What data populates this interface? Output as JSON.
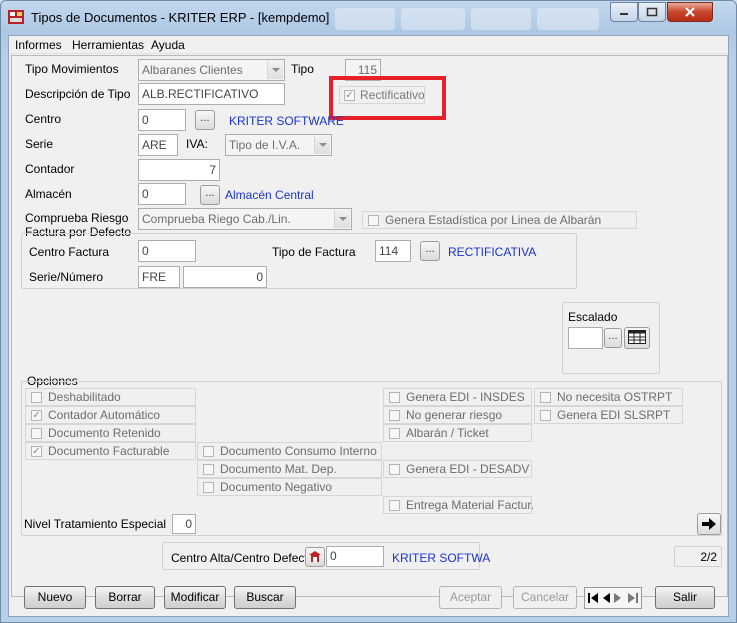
{
  "window": {
    "title": "Tipos de Documentos - KRITER ERP - [kempdemo]"
  },
  "menu": [
    "Informes",
    "Herramientas",
    "Ayuda"
  ],
  "form": {
    "tipo_movimientos_label": "Tipo Movimientos",
    "tipo_movimientos_value": "Albaranes Clientes",
    "tipo_label": "Tipo",
    "tipo_value": "115",
    "descripcion_label": "Descripción de Tipo",
    "descripcion_value": "ALB.RECTIFICATIVO",
    "rectificativo_label": "Rectificativo",
    "centro_label": "Centro",
    "centro_value": "0",
    "centro_name": "KRITER SOFTWARE",
    "serie_label": "Serie",
    "serie_value": "ARE",
    "iva_label": "IVA:",
    "iva_value": "Tipo de I.V.A.",
    "contador_label": "Contador",
    "contador_value": "7",
    "almacen_label": "Almacén",
    "almacen_value": "0",
    "almacen_name": "Almacén Central",
    "comprueba_label": "Comprueba Riesgo",
    "comprueba_value": "Comprueba Riego Cab./Lin.",
    "genera_estadistica_label": "Genera Estadística por Linea de Albarán",
    "factura_defecto_label": "Factura por Defecto",
    "centro_factura_label": "Centro Factura",
    "centro_factura_value": "0",
    "tipo_factura_label": "Tipo de Factura",
    "tipo_factura_value": "114",
    "tipo_factura_name": "RECTIFICATIVA",
    "serie_numero_label": "Serie/Número",
    "serie_numero_serie": "FRE",
    "serie_numero_numero": "0",
    "escalado_label": "Escalado"
  },
  "opciones": {
    "title": "Opciones",
    "col1": [
      {
        "label": "Deshabilitado",
        "checked": false
      },
      {
        "label": "Contador Automático",
        "checked": true
      },
      {
        "label": "Documento Retenido",
        "checked": false
      },
      {
        "label": "Documento Facturable",
        "checked": true
      }
    ],
    "col2": [
      {
        "label": "Documento Consumo Interno",
        "checked": false
      },
      {
        "label": "Documento Mat. Dep.",
        "checked": false
      },
      {
        "label": "Documento Negativo",
        "checked": false
      }
    ],
    "col3": [
      {
        "label": "Genera EDI - INSDES",
        "checked": false
      },
      {
        "label": "No generar riesgo",
        "checked": false
      },
      {
        "label": "Albarán / Ticket",
        "checked": false
      },
      {
        "label": "Genera EDI - DESADV",
        "checked": false
      },
      {
        "label": "Entrega Material Factur.",
        "checked": false
      }
    ],
    "col4": [
      {
        "label": "No necesita OSTRPT",
        "checked": false
      },
      {
        "label": "Genera EDI SLSRPT",
        "checked": false
      }
    ],
    "nivel_label": "Nivel Tratamiento Especial",
    "nivel_value": "0"
  },
  "footer_panel": {
    "centro_alta_label": "Centro Alta/Centro Defecto",
    "centro_alta_value": "0",
    "centro_alta_name": "KRITER SOFTWA",
    "page_indicator": "2/2"
  },
  "buttons": {
    "nuevo": "Nuevo",
    "borrar": "Borrar",
    "modificar": "Modificar",
    "buscar": "Buscar",
    "aceptar": "Aceptar",
    "cancelar": "Cancelar",
    "salir": "Salir"
  },
  "colors": {
    "highlight_border": "#e8202c",
    "link_blue": "#1a33d6"
  }
}
